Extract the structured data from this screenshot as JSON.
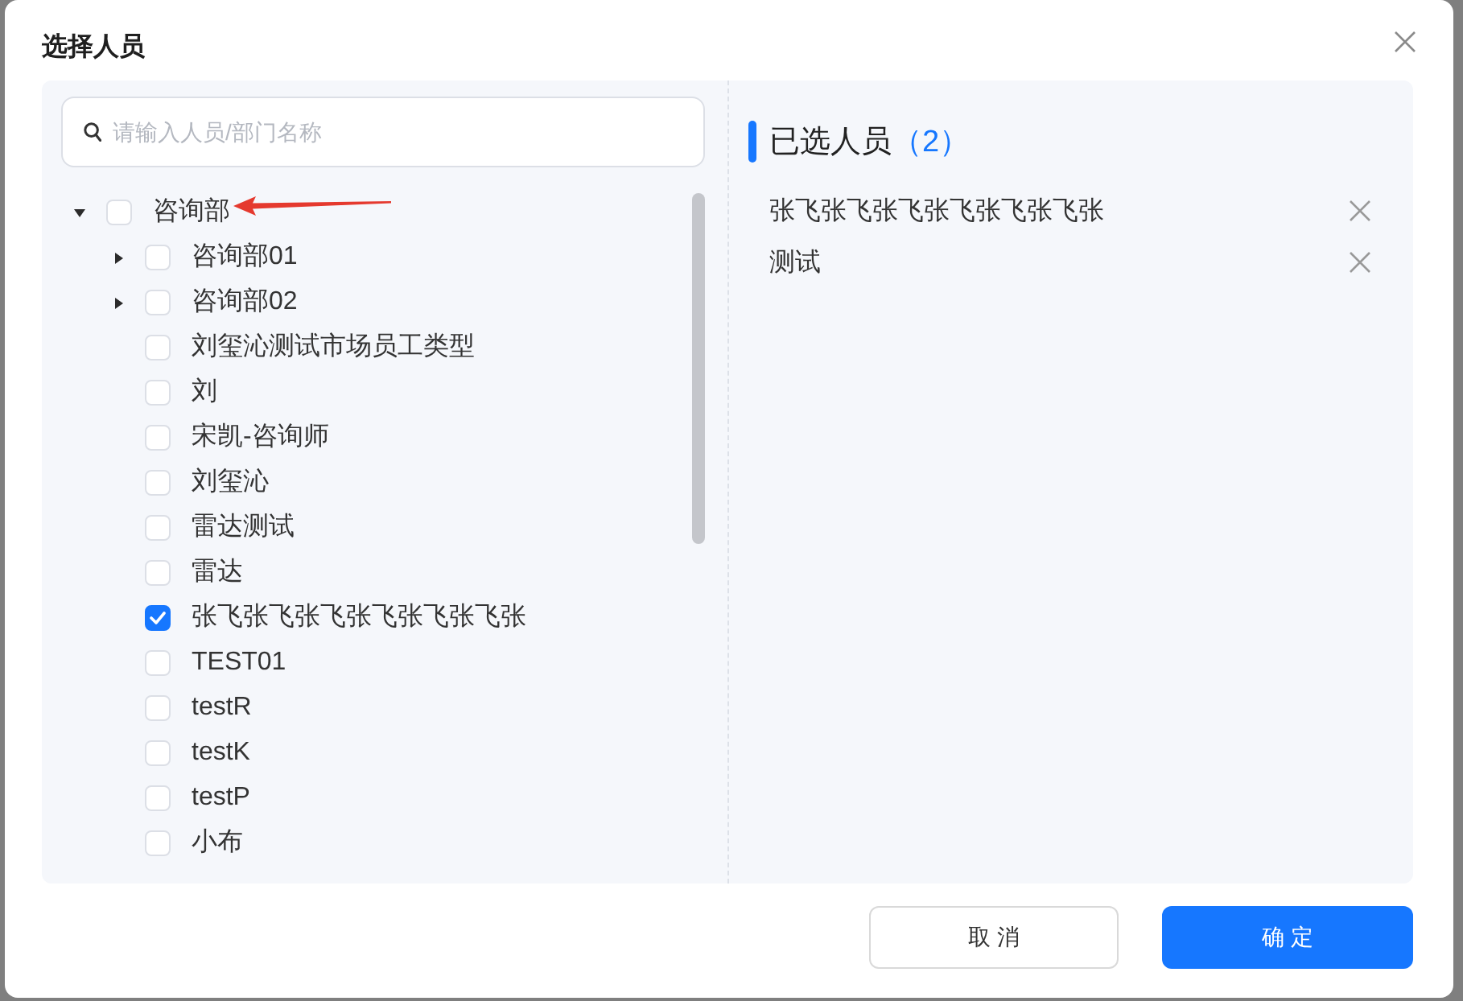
{
  "dialog": {
    "title": "选择人员"
  },
  "search": {
    "placeholder": "请输入人员/部门名称"
  },
  "tree": [
    {
      "label": "咨询部",
      "kind": "department",
      "expanded": true,
      "checked": false,
      "annotation": {
        "kind": "arrow"
      },
      "children": [
        {
          "label": "咨询部01",
          "kind": "department",
          "expanded": false,
          "checked": false
        },
        {
          "label": "咨询部02",
          "kind": "department",
          "expanded": false,
          "checked": false
        },
        {
          "label": "刘玺沁测试市场员工类型",
          "kind": "person",
          "checked": false
        },
        {
          "label": "刘",
          "kind": "person",
          "checked": false
        },
        {
          "label": "宋凯-咨询师",
          "kind": "person",
          "checked": false
        },
        {
          "label": "刘玺沁",
          "kind": "person",
          "checked": false
        },
        {
          "label": "雷达测试",
          "kind": "person",
          "checked": false
        },
        {
          "label": "雷达",
          "kind": "person",
          "checked": false
        },
        {
          "label": "张飞张飞张飞张飞张飞张飞张",
          "kind": "person",
          "checked": true
        },
        {
          "label": "TEST01",
          "kind": "person",
          "checked": false
        },
        {
          "label": "testR",
          "kind": "person",
          "checked": false
        },
        {
          "label": "testK",
          "kind": "person",
          "checked": false
        },
        {
          "label": "testP",
          "kind": "person",
          "checked": false
        },
        {
          "label": "小布",
          "kind": "person",
          "checked": false
        }
      ]
    }
  ],
  "selected": {
    "title": "已选人员",
    "count": "（2）",
    "items": [
      {
        "name": "张飞张飞张飞张飞张飞张飞张"
      },
      {
        "name": "测试"
      }
    ]
  },
  "buttons": [
    {
      "label": "取 消",
      "kind": "secondary"
    },
    {
      "label": "确 定",
      "kind": "primary"
    }
  ]
}
